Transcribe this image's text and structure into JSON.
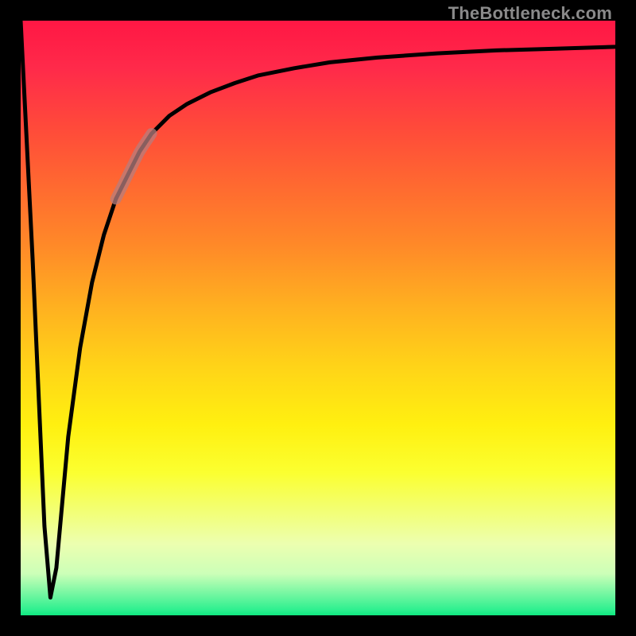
{
  "attribution": "TheBottleneck.com",
  "colors": {
    "frame": "#000000",
    "curve": "#000000",
    "highlight": "#b77e7e",
    "gradient_top": "#ff1744",
    "gradient_bottom": "#10e880"
  },
  "chart_data": {
    "type": "line",
    "title": "",
    "xlabel": "",
    "ylabel": "",
    "xlim": [
      0,
      100
    ],
    "ylim": [
      0,
      100
    ],
    "grid": false,
    "series": [
      {
        "name": "bottleneck-curve",
        "x": [
          0,
          2,
          4,
          5,
          6,
          8,
          10,
          12,
          14,
          16,
          18,
          20,
          22,
          25,
          28,
          32,
          36,
          40,
          46,
          52,
          60,
          70,
          80,
          90,
          100
        ],
        "y": [
          100,
          60,
          15,
          3,
          8,
          30,
          45,
          56,
          64,
          70,
          74,
          78,
          81,
          84,
          86,
          88,
          89.5,
          90.8,
          92,
          93,
          93.8,
          94.5,
          95,
          95.3,
          95.6
        ]
      }
    ],
    "highlight_range_x": [
      16,
      22
    ],
    "annotations": []
  }
}
